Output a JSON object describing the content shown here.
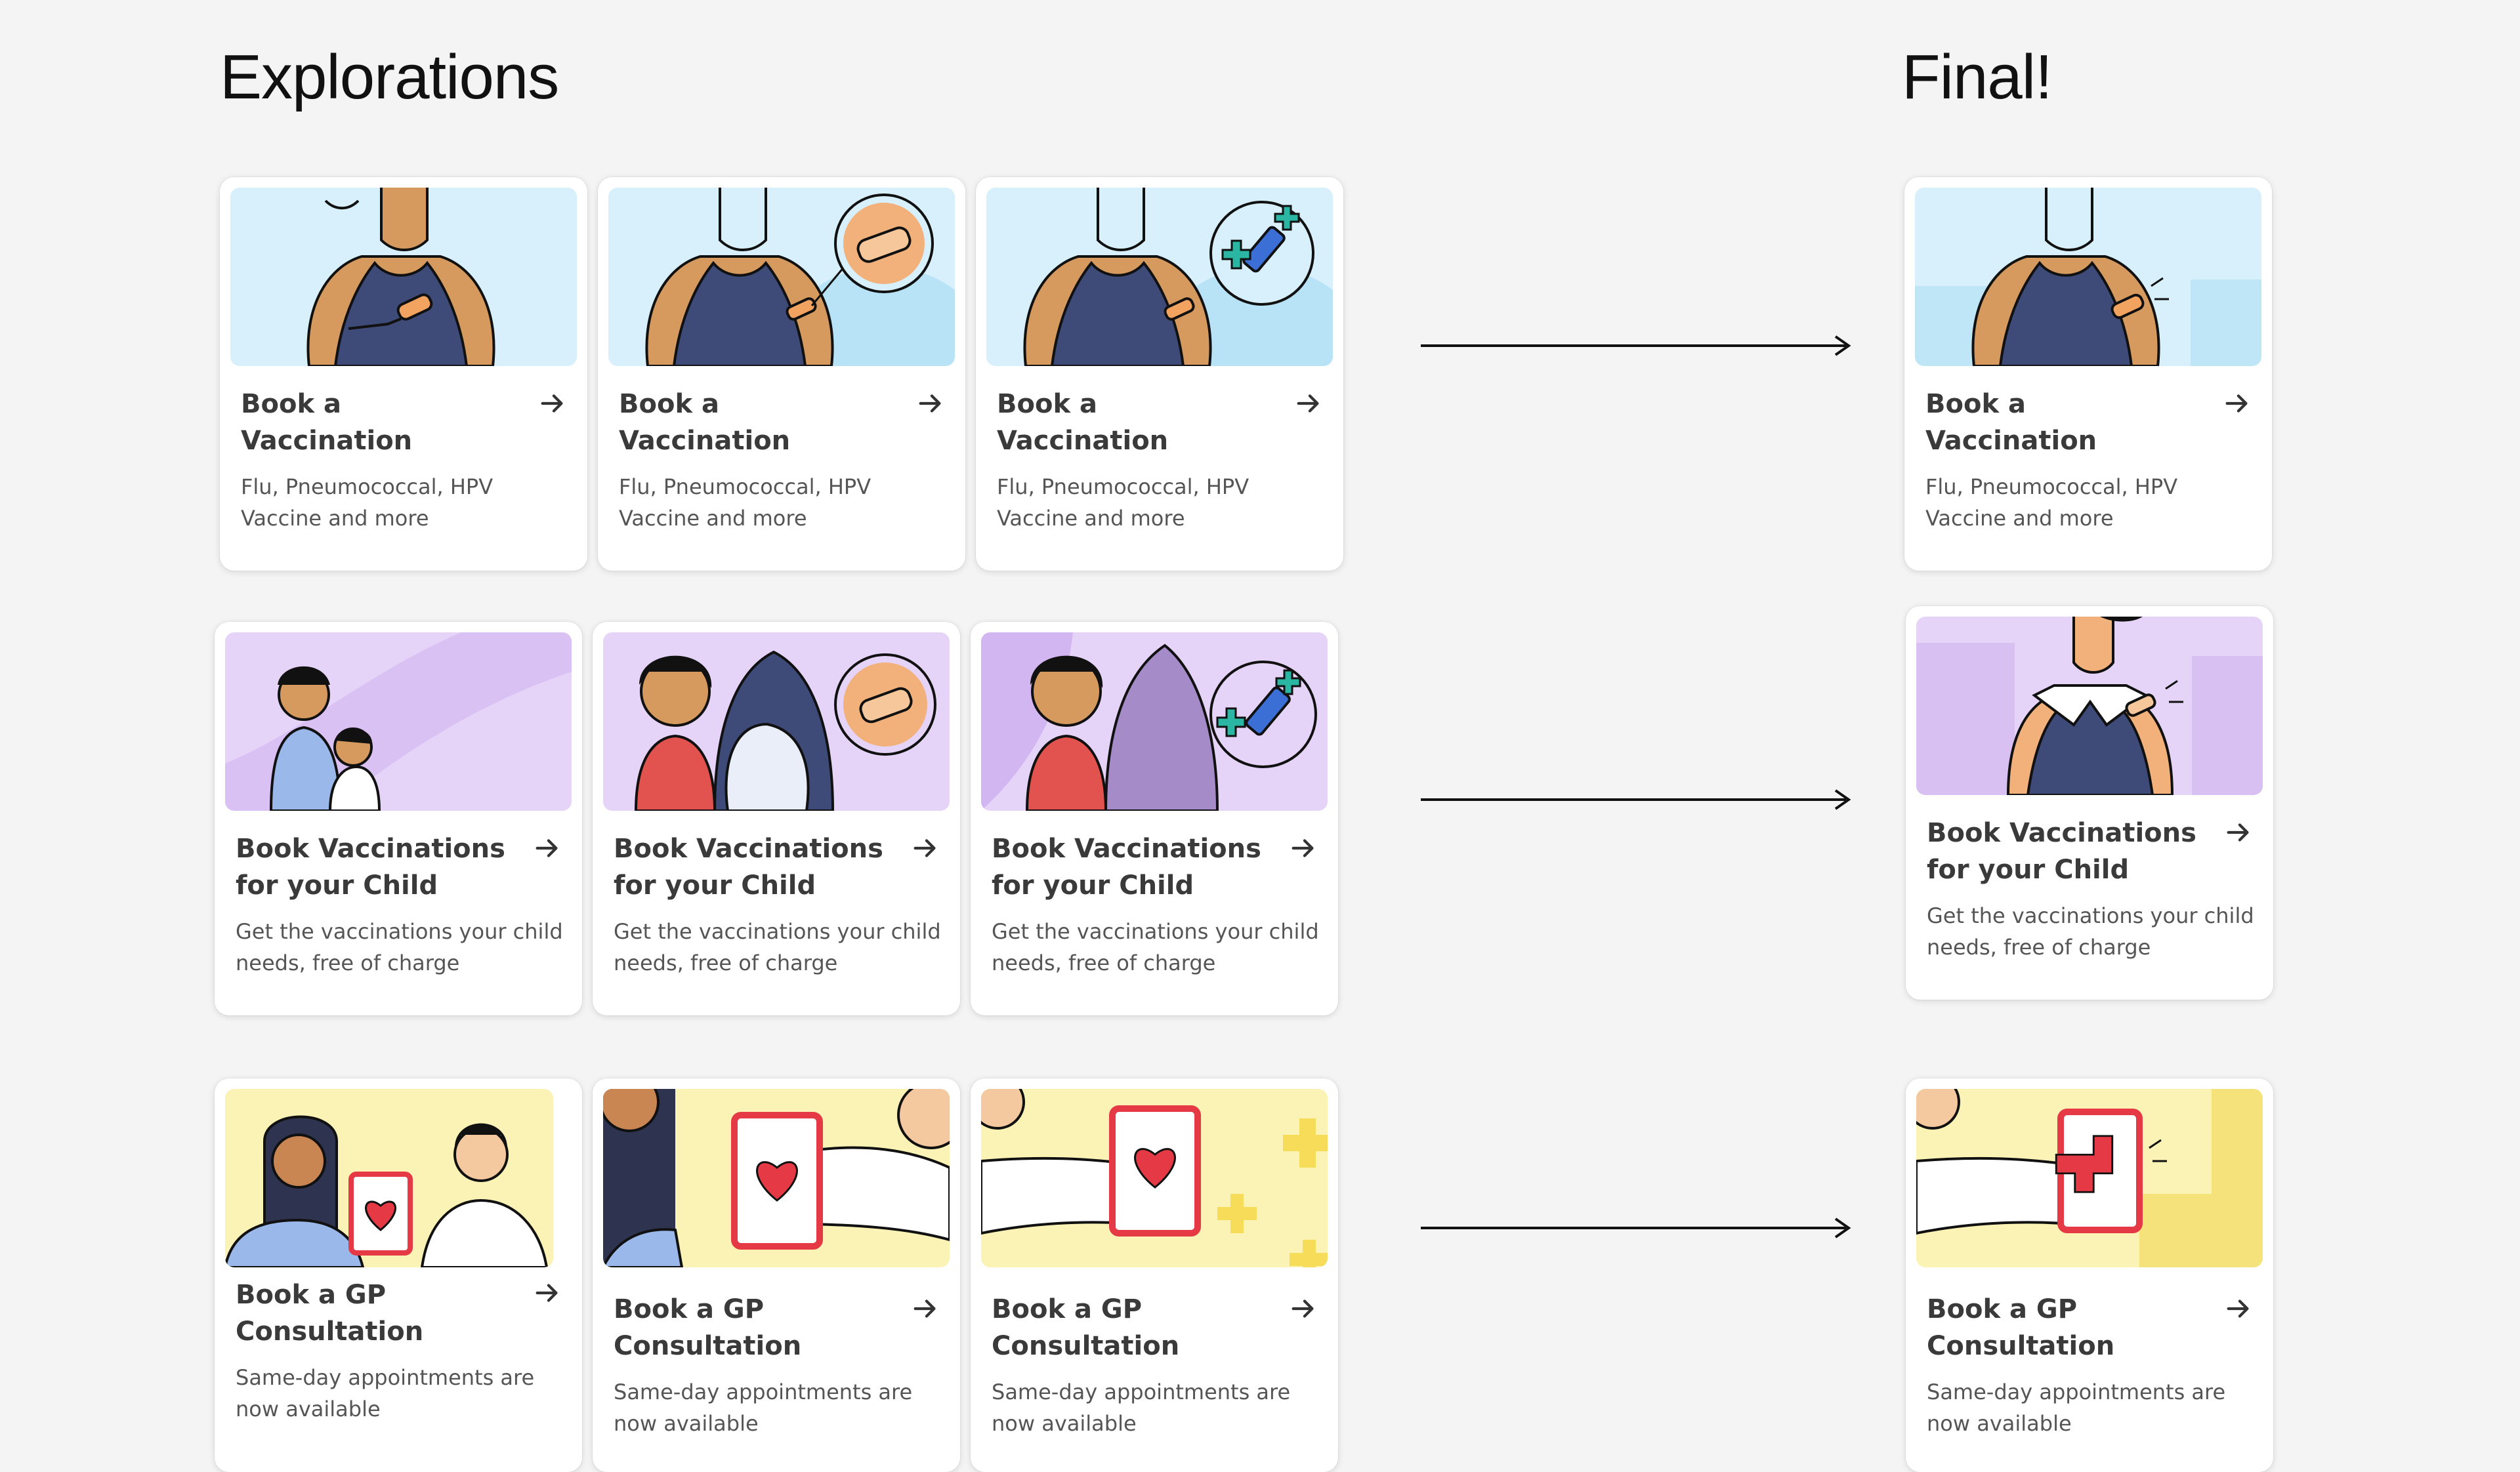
{
  "headings": {
    "explorations": "Explorations",
    "final": "Final!"
  },
  "cards": {
    "vaccination": {
      "title": "Book a Vaccination",
      "description": "Flu, Pneumococcal, HPV Vaccine and more"
    },
    "child": {
      "title": "Book Vaccinations for your Child",
      "description": "Get the vaccinations your child needs, free of charge"
    },
    "gp": {
      "title": "Book a GP Consultation",
      "description": "Same-day appointments are now available"
    }
  },
  "colors": {
    "vaccination_bg": "#d7f0fb",
    "child_bg": "#e6d4f8",
    "gp_bg": "#fbf2b5",
    "skin": "#d69a5e",
    "shirt": "#3e4a78",
    "heart": "#e53945",
    "teal_cross": "#2bb5a3"
  },
  "icons": [
    "arrow-right-icon",
    "long-arrow-icon"
  ]
}
